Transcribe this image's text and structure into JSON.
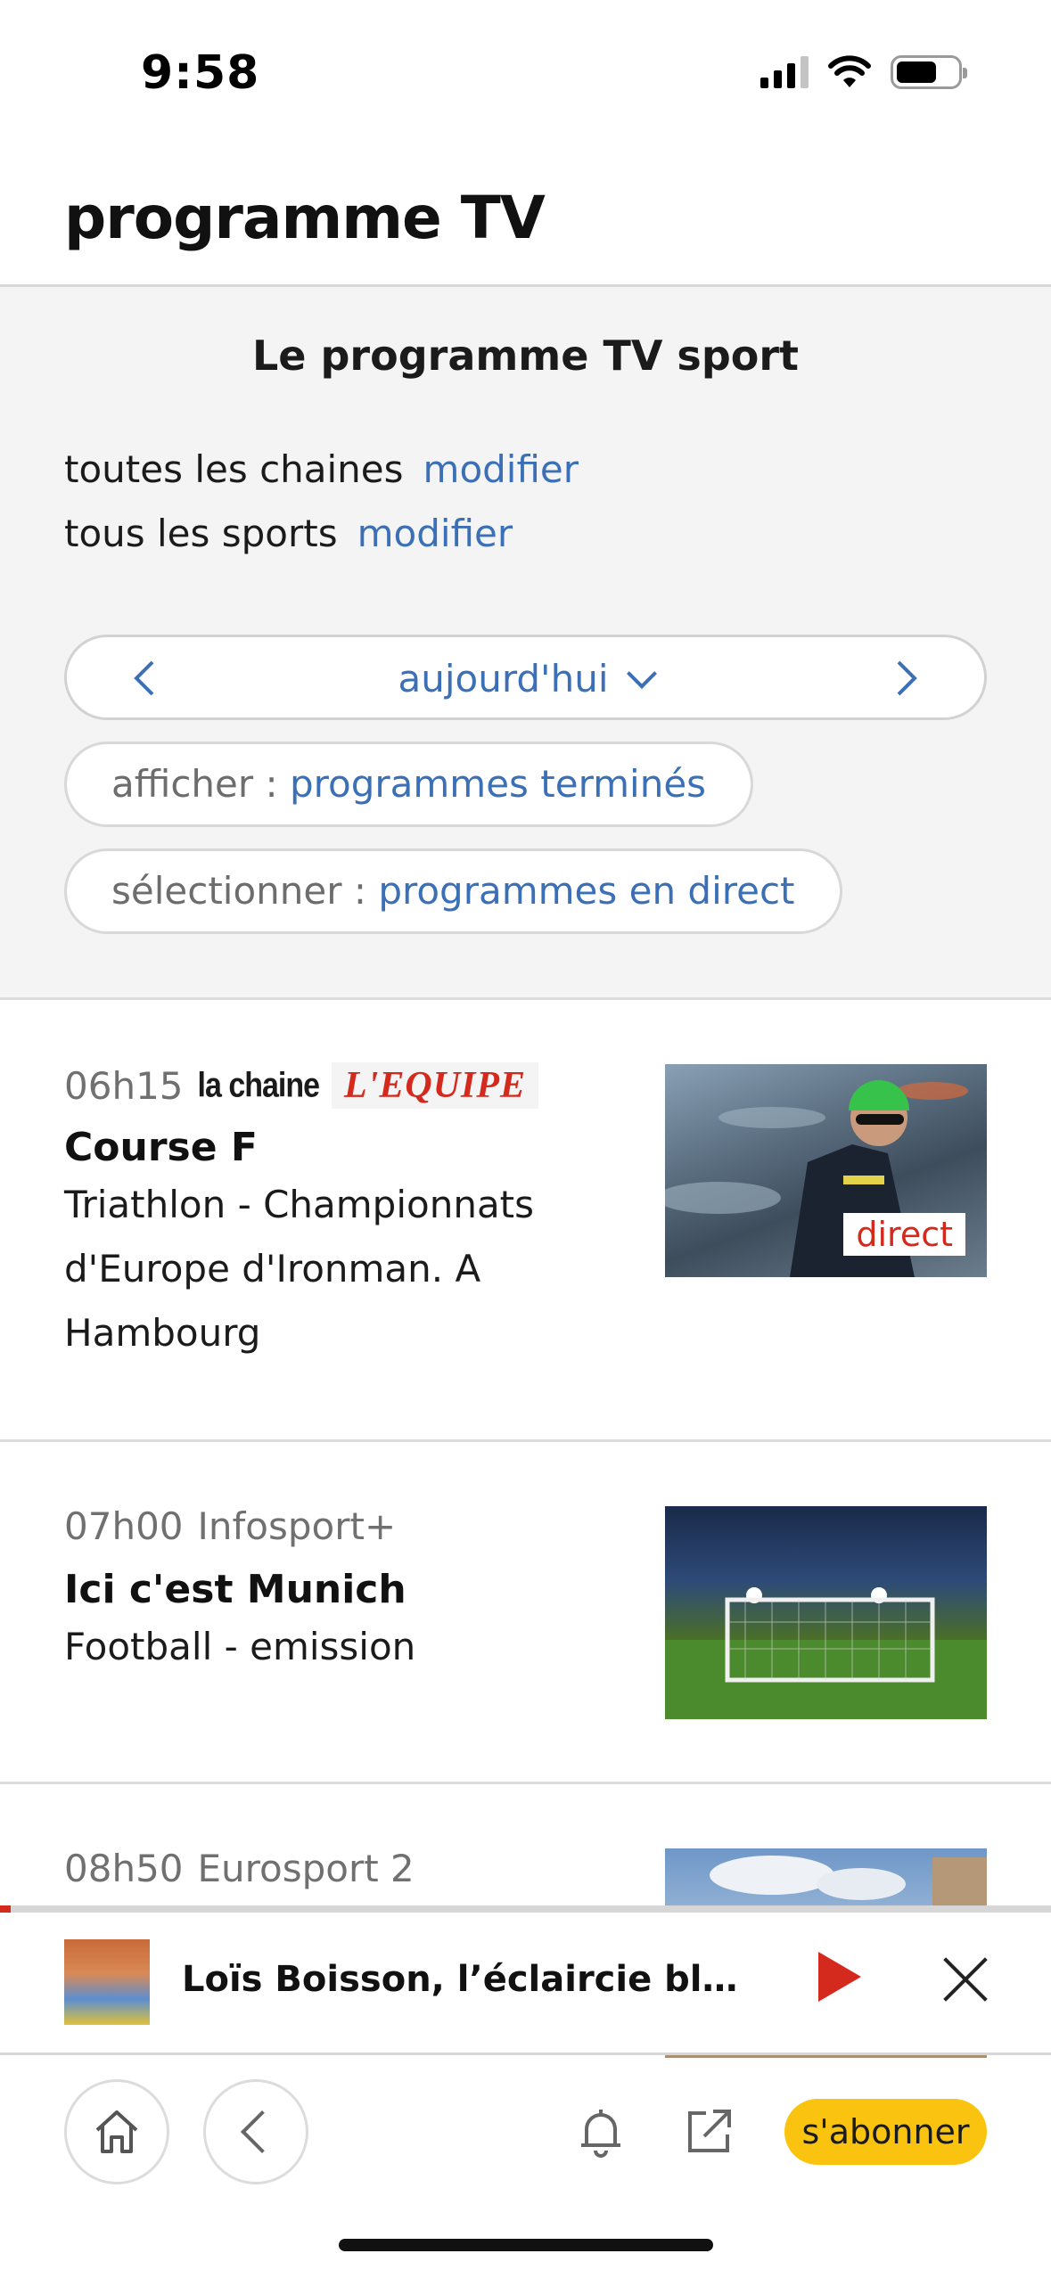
{
  "status_bar": {
    "time": "9:58"
  },
  "header": {
    "title": "programme TV"
  },
  "filters": {
    "heading": "Le programme TV sport",
    "channels_label": "toutes les chaines",
    "channels_link": "modifier",
    "sports_label": "tous les sports",
    "sports_link": "modifier",
    "date_label": "aujourd'hui",
    "show_key": "afficher : ",
    "show_value": "programmes terminés",
    "select_key": "sélectionner : ",
    "select_value": "programmes en direct"
  },
  "programs": [
    {
      "time": "06h15",
      "channel_prefix": "la chaine",
      "channel_brand": "L'EQUIPE",
      "title": "Course F",
      "description": "Triathlon - Championnats d'Europe d'Ironman. A Hambourg",
      "badge": "direct"
    },
    {
      "time": "07h00",
      "channel": "Infosport+",
      "title": "Ici c'est Munich",
      "description": "Football - emission"
    },
    {
      "time": "08h50",
      "channel": "Eurosport 2"
    }
  ],
  "mini_player": {
    "title": "Loïs Boisson, l’éclaircie bleue...",
    "progress": 0.01
  },
  "toolbar": {
    "subscribe_label": "s'abonner"
  },
  "icons": {
    "signal": "signal-icon",
    "wifi": "wifi-icon",
    "battery": "battery-icon",
    "home": "home-icon",
    "back": "chevron-left-icon",
    "bell": "bell-icon",
    "share": "share-icon",
    "play": "play-icon",
    "close": "close-icon"
  },
  "colors": {
    "accent_blue": "#3b6fb6",
    "brand_red": "#d42a1e",
    "subscribe_yellow": "#f9c30f"
  }
}
